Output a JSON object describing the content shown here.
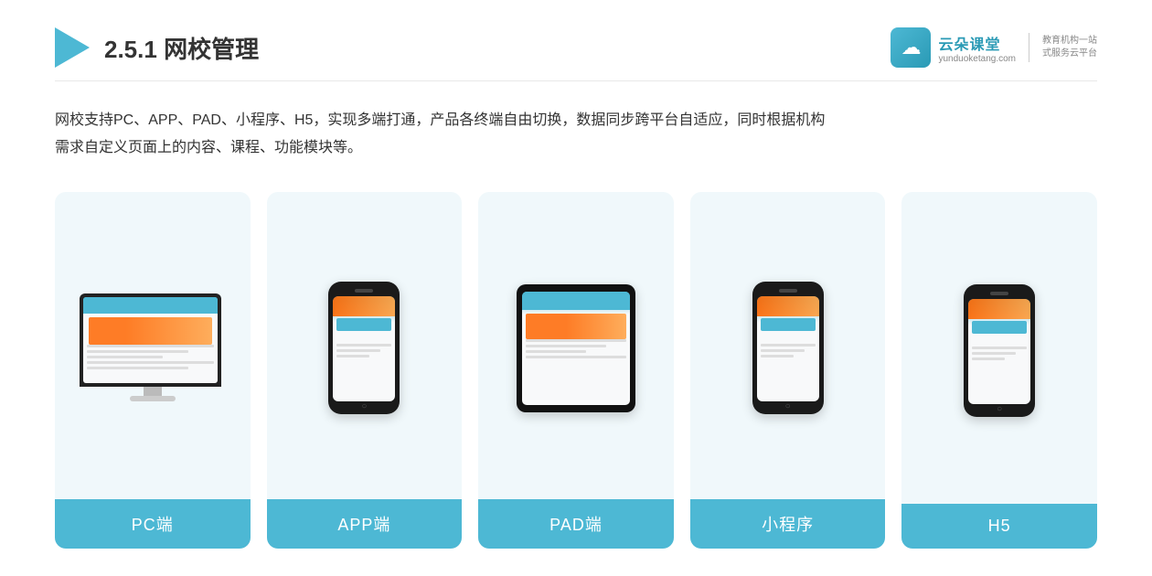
{
  "header": {
    "section_number": "2.5.1",
    "title_plain": "网校管理",
    "logo_icon": "☁",
    "brand_name": "云朵课堂",
    "brand_url": "yunduoketang.com",
    "slogan_line1": "教育机构一站",
    "slogan_line2": "式服务云平台"
  },
  "description": {
    "text_line1": "网校支持PC、APP、PAD、小程序、H5，实现多端打通，产品各终端自由切换，数据同步跨平台自适应，同时根据机构",
    "text_line2": "需求自定义页面上的内容、课程、功能模块等。"
  },
  "cards": [
    {
      "id": "pc",
      "label": "PC端",
      "device_type": "monitor"
    },
    {
      "id": "app",
      "label": "APP端",
      "device_type": "phone"
    },
    {
      "id": "pad",
      "label": "PAD端",
      "device_type": "tablet"
    },
    {
      "id": "miniprogram",
      "label": "小程序",
      "device_type": "phone"
    },
    {
      "id": "h5",
      "label": "H5",
      "device_type": "phone"
    }
  ],
  "colors": {
    "accent": "#4db8d4",
    "background_card": "#eef7fb",
    "text_dark": "#333333",
    "text_light": "#888888"
  }
}
